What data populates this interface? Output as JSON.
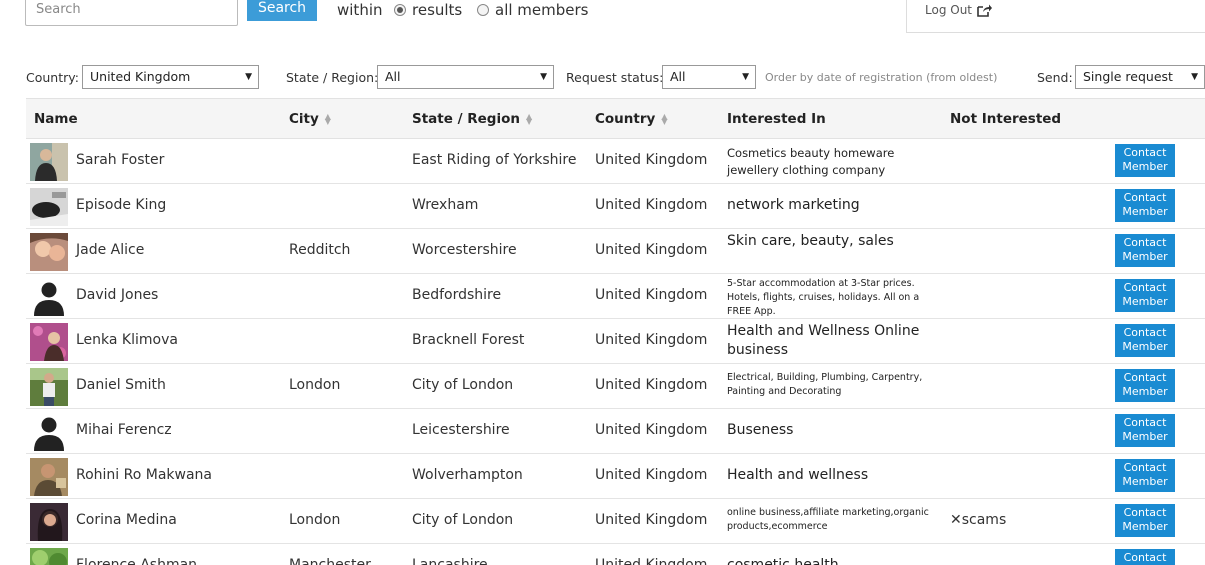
{
  "search": {
    "placeholder": "Search",
    "button": "Search",
    "within": "within",
    "options": [
      "results",
      "all members"
    ],
    "selected": "results"
  },
  "account": {
    "logout": "Log Out"
  },
  "filters": {
    "country_label": "Country:",
    "country_value": "United Kingdom",
    "state_label": "State / Region:",
    "state_value": "All",
    "status_label": "Request status:",
    "status_value": "All",
    "order_note": "Order by date of registration (from oldest)",
    "send_label": "Send:",
    "send_value": "Single request"
  },
  "columns": {
    "name": "Name",
    "city": "City",
    "state": "State / Region",
    "country": "Country",
    "interested": "Interested In",
    "not_interested": "Not Interested"
  },
  "contact_label_1": "Contact",
  "contact_label_2": "Member",
  "members": [
    {
      "name": "Sarah Foster",
      "city": "",
      "state": "East Riding of Yorkshire",
      "country": "United Kingdom",
      "interest": "Cosmetics beauty homeware jewellery clothing company",
      "interest_size": "small",
      "not_interested": "",
      "avatar": "photo-gray"
    },
    {
      "name": "Episode King",
      "city": "",
      "state": "Wrexham",
      "country": "United Kingdom",
      "interest": "network marketing",
      "interest_size": "normal",
      "not_interested": "",
      "avatar": "photo-mono"
    },
    {
      "name": "Jade Alice",
      "city": "Redditch",
      "state": "Worcestershire",
      "country": "United Kingdom",
      "interest": "Skin care, beauty, sales",
      "interest_size": "normal",
      "not_interested": "",
      "avatar": "photo-warm"
    },
    {
      "name": "David Jones",
      "city": "",
      "state": "Bedfordshire",
      "country": "United Kingdom",
      "interest": "5-Star accommodation at 3-Star prices. Hotels, flights, cruises, holidays. All on a FREE App.",
      "interest_size": "tiny",
      "not_interested": "",
      "avatar": "silhouette"
    },
    {
      "name": "Lenka Klimova",
      "city": "",
      "state": "Bracknell Forest",
      "country": "United Kingdom",
      "interest": "Health and Wellness Online business",
      "interest_size": "normal",
      "not_interested": "",
      "avatar": "photo-pink"
    },
    {
      "name": "Daniel Smith",
      "city": "London",
      "state": "City of London",
      "country": "United Kingdom",
      "interest": "Electrical, Building, Plumbing, Carpentry, Painting and Decorating",
      "interest_size": "tiny",
      "not_interested": "",
      "avatar": "photo-green"
    },
    {
      "name": "Mihai Ferencz",
      "city": "",
      "state": "Leicestershire",
      "country": "United Kingdom",
      "interest": "Buseness",
      "interest_size": "normal",
      "not_interested": "",
      "avatar": "silhouette"
    },
    {
      "name": "Rohini Ro Makwana",
      "city": "",
      "state": "Wolverhampton",
      "country": "United Kingdom",
      "interest": "Health and wellness",
      "interest_size": "normal",
      "not_interested": "",
      "avatar": "photo-tan"
    },
    {
      "name": "Corina Medina",
      "city": "London",
      "state": "City of London",
      "country": "United Kingdom",
      "interest": "online business,affiliate marketing,organic products,ecommerce",
      "interest_size": "tiny",
      "not_interested": "scams",
      "avatar": "photo-dark"
    },
    {
      "name": "Florence Ashman",
      "city": "Manchester",
      "state": "Lancashire",
      "country": "United Kingdom",
      "interest": "cosmetic health",
      "interest_size": "normal",
      "not_interested": "",
      "avatar": "photo-leaf"
    }
  ]
}
